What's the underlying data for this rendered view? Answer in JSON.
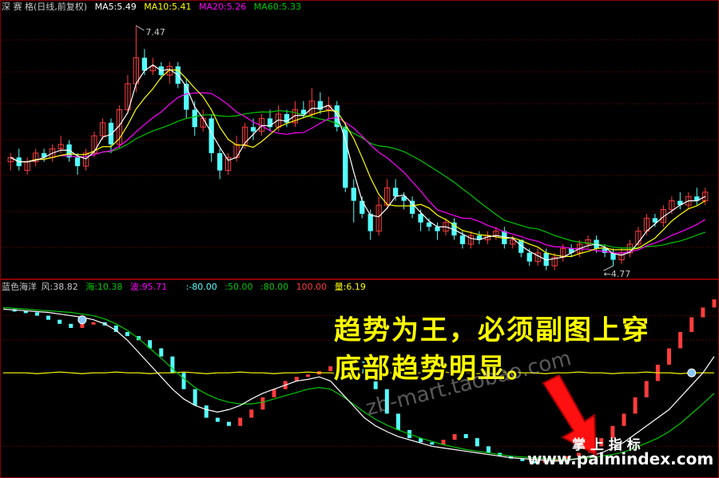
{
  "main_header": {
    "title": "深 赛 格(日线,前复权)",
    "ma5": "MA5:5.49",
    "ma10": "MA10:5.41",
    "ma20": "MA20:5.26",
    "ma60": "MA60:5.33"
  },
  "sub_header": {
    "name": "蓝色海洋",
    "feng": "风:38.82",
    "hai": "海:10.38",
    "bo": "波:95.71",
    "l1": ":-80.00",
    "l2": ":50.00",
    "l3": ":80.00",
    "l4": "100.00",
    "liang": "量:6.19"
  },
  "colors": {
    "up": "#ff3c3c",
    "down": "#54ffff",
    "ma5": "#ffffff",
    "ma10": "#ffff00",
    "ma20": "#ff00ff",
    "ma60": "#00c800",
    "sub_yellow": "#ffff00",
    "sub_white": "#ffffff",
    "sub_green": "#00c800",
    "grid": "#8b0000"
  },
  "annotations": {
    "line1": "趋势为王，必须副图上穿",
    "line2": "底部趋势明显。",
    "brand": "掌 上 指 标",
    "site": "www.palmindex.com",
    "watermark": "zb-mart.taobao.com"
  },
  "chart_data": [
    {
      "type": "candlestick",
      "title": "深 赛 格(日线,前复权)",
      "ylim": [
        4.6,
        7.6
      ],
      "high_label": "7.47",
      "low_label": "4.77",
      "candles": [
        [
          5.9,
          5.95,
          5.8,
          6.0
        ],
        [
          5.95,
          5.85,
          5.8,
          6.05
        ],
        [
          5.8,
          5.9,
          5.75,
          5.95
        ],
        [
          5.9,
          6.0,
          5.85,
          6.05
        ],
        [
          6.0,
          5.95,
          5.9,
          6.05
        ],
        [
          5.95,
          6.05,
          5.9,
          6.1
        ],
        [
          6.05,
          6.1,
          6.0,
          6.2
        ],
        [
          6.1,
          5.95,
          5.9,
          6.15
        ],
        [
          5.95,
          5.85,
          5.75,
          6.0
        ],
        [
          5.85,
          6.0,
          5.8,
          6.05
        ],
        [
          6.0,
          6.2,
          5.95,
          6.25
        ],
        [
          6.2,
          6.35,
          6.15,
          6.4
        ],
        [
          6.35,
          6.1,
          6.0,
          6.4
        ],
        [
          6.1,
          6.5,
          6.05,
          6.55
        ],
        [
          6.5,
          6.8,
          6.45,
          6.9
        ],
        [
          6.8,
          7.1,
          6.7,
          7.47
        ],
        [
          7.1,
          6.95,
          6.9,
          7.2
        ],
        [
          6.95,
          7.0,
          6.9,
          7.1
        ],
        [
          7.0,
          6.9,
          6.85,
          7.05
        ],
        [
          6.9,
          7.0,
          6.8,
          7.05
        ],
        [
          7.0,
          6.8,
          6.75,
          7.05
        ],
        [
          6.8,
          6.5,
          6.4,
          6.85
        ],
        [
          6.5,
          6.3,
          6.2,
          6.6
        ],
        [
          6.3,
          6.4,
          6.25,
          6.5
        ],
        [
          6.4,
          6.0,
          5.9,
          6.45
        ],
        [
          6.0,
          5.8,
          5.7,
          6.05
        ],
        [
          5.8,
          5.95,
          5.75,
          6.0
        ],
        [
          5.95,
          6.1,
          5.9,
          6.2
        ],
        [
          6.1,
          6.3,
          6.05,
          6.35
        ],
        [
          6.3,
          6.25,
          6.15,
          6.4
        ],
        [
          6.25,
          6.4,
          6.2,
          6.45
        ],
        [
          6.4,
          6.3,
          6.25,
          6.5
        ],
        [
          6.3,
          6.45,
          6.25,
          6.55
        ],
        [
          6.45,
          6.35,
          6.3,
          6.5
        ],
        [
          6.35,
          6.5,
          6.3,
          6.6
        ],
        [
          6.5,
          6.45,
          6.4,
          6.6
        ],
        [
          6.45,
          6.6,
          6.4,
          6.75
        ],
        [
          6.6,
          6.5,
          6.45,
          6.7
        ],
        [
          6.5,
          6.55,
          6.4,
          6.65
        ],
        [
          6.55,
          6.3,
          6.25,
          6.6
        ],
        [
          6.3,
          5.6,
          5.55,
          6.35
        ],
        [
          5.6,
          5.45,
          5.2,
          5.7
        ],
        [
          5.45,
          5.3,
          5.25,
          5.5
        ],
        [
          5.3,
          5.1,
          5.0,
          5.35
        ],
        [
          5.1,
          5.4,
          5.05,
          5.5
        ],
        [
          5.4,
          5.6,
          5.35,
          5.7
        ],
        [
          5.6,
          5.5,
          5.45,
          5.7
        ],
        [
          5.5,
          5.45,
          5.35,
          5.55
        ],
        [
          5.45,
          5.3,
          5.25,
          5.5
        ],
        [
          5.3,
          5.2,
          5.1,
          5.35
        ],
        [
          5.2,
          5.15,
          5.1,
          5.25
        ],
        [
          5.15,
          5.1,
          5.0,
          5.2
        ],
        [
          5.1,
          5.2,
          5.05,
          5.25
        ],
        [
          5.2,
          5.05,
          5.0,
          5.25
        ],
        [
          5.05,
          4.95,
          4.9,
          5.1
        ],
        [
          4.95,
          5.05,
          4.9,
          5.1
        ],
        [
          5.05,
          5.0,
          4.95,
          5.1
        ],
        [
          5.0,
          5.05,
          4.95,
          5.1
        ],
        [
          5.05,
          5.1,
          5.0,
          5.15
        ],
        [
          5.1,
          4.95,
          4.9,
          5.15
        ],
        [
          4.95,
          5.0,
          4.9,
          5.05
        ],
        [
          5.0,
          4.85,
          4.8,
          5.0
        ],
        [
          4.85,
          4.75,
          4.7,
          4.9
        ],
        [
          4.75,
          4.85,
          4.7,
          4.9
        ],
        [
          4.85,
          4.7,
          4.65,
          4.9
        ],
        [
          4.7,
          4.8,
          4.65,
          4.85
        ],
        [
          4.8,
          4.9,
          4.75,
          4.95
        ],
        [
          4.9,
          4.85,
          4.8,
          4.95
        ],
        [
          4.85,
          4.95,
          4.8,
          5.0
        ],
        [
          4.95,
          5.0,
          4.9,
          5.05
        ],
        [
          5.0,
          4.9,
          4.85,
          5.05
        ],
        [
          4.9,
          4.85,
          4.8,
          4.95
        ],
        [
          4.85,
          4.77,
          4.7,
          4.9
        ],
        [
          4.77,
          4.85,
          4.72,
          4.9
        ],
        [
          4.85,
          4.95,
          4.8,
          5.0
        ],
        [
          4.95,
          5.1,
          4.9,
          5.15
        ],
        [
          5.1,
          5.25,
          5.05,
          5.3
        ],
        [
          5.25,
          5.2,
          5.15,
          5.3
        ],
        [
          5.2,
          5.35,
          5.15,
          5.4
        ],
        [
          5.35,
          5.45,
          5.3,
          5.5
        ],
        [
          5.45,
          5.4,
          5.35,
          5.55
        ],
        [
          5.4,
          5.5,
          5.35,
          5.55
        ],
        [
          5.5,
          5.45,
          5.4,
          5.6
        ],
        [
          5.45,
          5.55,
          5.4,
          5.6
        ]
      ]
    },
    {
      "type": "line",
      "title": "蓝色海洋",
      "ylim": [
        -110,
        105
      ],
      "series": [
        {
          "name": "风",
          "values": [
            88,
            86,
            84,
            80,
            75,
            70,
            65,
            70,
            72,
            68,
            60,
            55,
            50,
            40,
            30,
            10,
            -10,
            -30,
            -45,
            -50,
            -55,
            -45,
            -35,
            -20,
            -10,
            0,
            5,
            8,
            12,
            18,
            22,
            25,
            10,
            -10,
            -40,
            -60,
            -70,
            -75,
            -78,
            -72,
            -65,
            -70,
            -80,
            -88,
            -92,
            -95,
            -98,
            -100,
            -97,
            -95,
            -92,
            -88,
            -80,
            -70,
            -55,
            -40,
            -20,
            0,
            20,
            40,
            60,
            78,
            90,
            100
          ]
        },
        {
          "name": "海",
          "values": [
            10,
            10,
            10,
            9,
            10,
            11,
            10,
            9,
            10,
            10,
            11,
            10,
            10,
            9,
            10,
            10,
            11,
            10,
            9,
            10,
            10,
            11,
            10,
            10,
            9,
            10,
            10,
            11,
            10,
            10,
            9,
            10,
            10,
            11,
            10,
            10,
            9,
            10,
            10,
            11,
            10,
            10,
            9,
            10,
            10,
            11,
            10,
            10,
            9,
            10,
            10,
            11,
            10,
            10,
            9,
            10,
            10,
            11,
            10,
            10,
            9,
            10,
            10,
            10
          ]
        },
        {
          "name": "波",
          "values": [
            88,
            87,
            86,
            85,
            84,
            82,
            80,
            78,
            75,
            70,
            62,
            50,
            35,
            20,
            5,
            -10,
            -22,
            -30,
            -35,
            -38,
            -35,
            -30,
            -22,
            -15,
            -10,
            -5,
            0,
            2,
            5,
            0,
            -15,
            -30,
            -45,
            -55,
            -62,
            -68,
            -72,
            -76,
            -80,
            -82,
            -84,
            -86,
            -88,
            -90,
            -92,
            -94,
            -95,
            -96,
            -97,
            -98,
            -97,
            -95,
            -92,
            -88,
            -82,
            -75,
            -65,
            -55,
            -45,
            -35,
            -20,
            -5,
            10,
            30
          ]
        },
        {
          "name": "绿线",
          "values": [
            90,
            89,
            88,
            87,
            86,
            85,
            84,
            82,
            80,
            76,
            70,
            62,
            52,
            40,
            28,
            15,
            3,
            -8,
            -16,
            -22,
            -26,
            -28,
            -28,
            -26,
            -22,
            -18,
            -14,
            -10,
            -8,
            -10,
            -18,
            -28,
            -38,
            -47,
            -54,
            -60,
            -65,
            -70,
            -74,
            -78,
            -81,
            -84,
            -86,
            -88,
            -90,
            -92,
            -93,
            -94,
            -95,
            -96,
            -96,
            -95,
            -94,
            -92,
            -90,
            -87,
            -82,
            -76,
            -70,
            -62,
            -52,
            -40,
            -28,
            -15
          ]
        }
      ]
    }
  ]
}
